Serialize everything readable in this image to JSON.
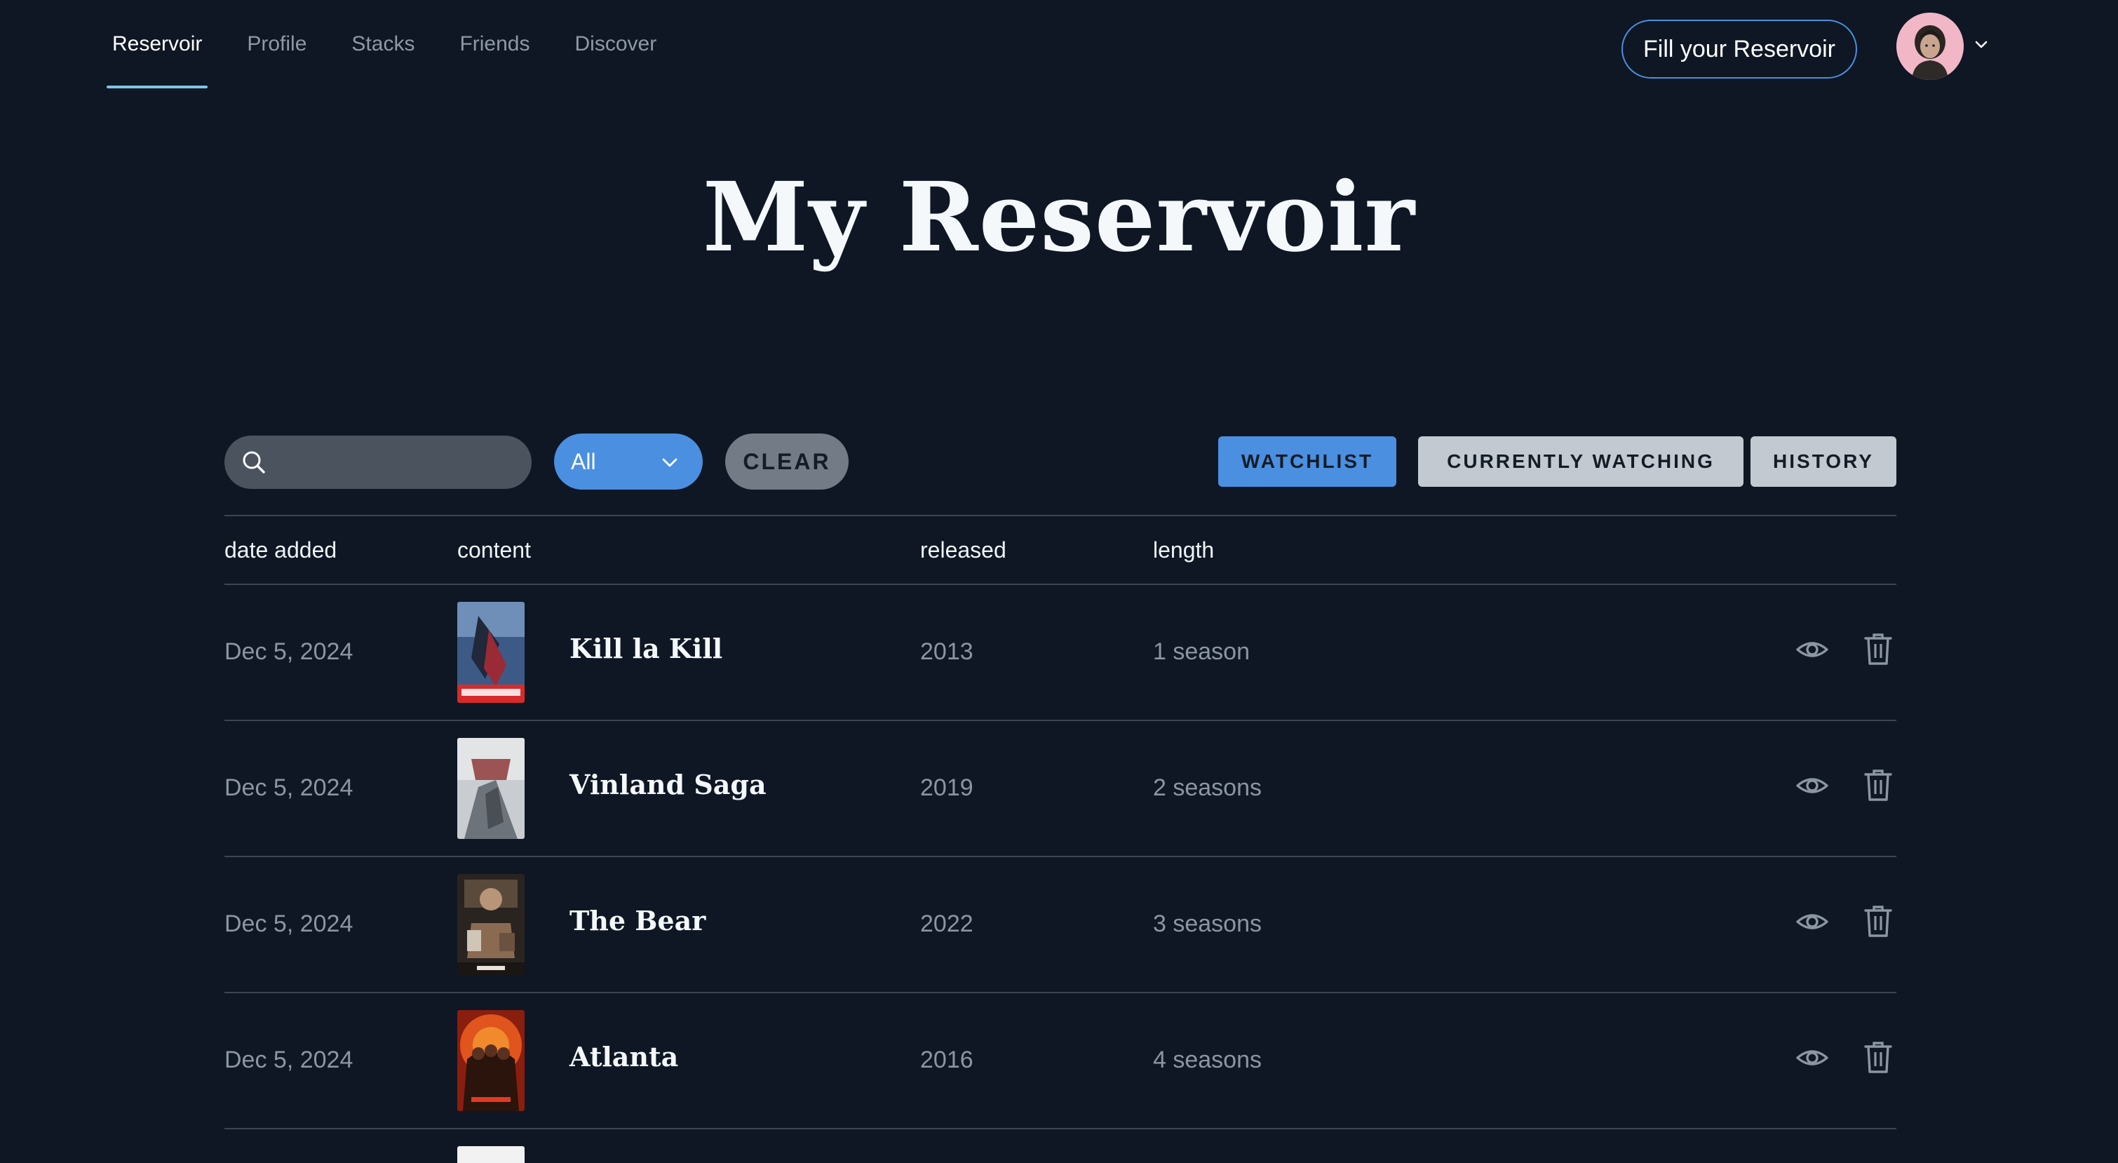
{
  "nav": {
    "tabs": [
      {
        "label": "Reservoir",
        "active": true
      },
      {
        "label": "Profile",
        "active": false
      },
      {
        "label": "Stacks",
        "active": false
      },
      {
        "label": "Friends",
        "active": false
      },
      {
        "label": "Discover",
        "active": false
      }
    ],
    "fill_button": "Fill your Reservoir",
    "avatar_icon": "user-avatar",
    "menu_icon": "chevron-down-icon"
  },
  "page": {
    "title": "My Reservoir"
  },
  "toolbar": {
    "search_value": "",
    "search_placeholder": "",
    "filter_value": "All",
    "clear_label": "CLEAR",
    "status_tabs": {
      "watchlist": "WATCHLIST",
      "watching": "CURRENTLY WATCHING",
      "history": "HISTORY"
    },
    "active_status": "WATCHLIST"
  },
  "table": {
    "headers": {
      "date": "date added",
      "content": "content",
      "released": "released",
      "length": "length"
    },
    "rows": [
      {
        "date": "Dec 5, 2024",
        "title": "Kill la Kill",
        "released": "2013",
        "length": "1 season"
      },
      {
        "date": "Dec 5, 2024",
        "title": "Vinland Saga",
        "released": "2019",
        "length": "2 seasons"
      },
      {
        "date": "Dec 5, 2024",
        "title": "The Bear",
        "released": "2022",
        "length": "3 seasons"
      },
      {
        "date": "Dec 5, 2024",
        "title": "Atlanta",
        "released": "2016",
        "length": "4 seasons"
      }
    ]
  },
  "colors": {
    "background": "#0e1723",
    "accent_blue": "#4a8fe0",
    "active_underline": "#7fc4e4"
  }
}
